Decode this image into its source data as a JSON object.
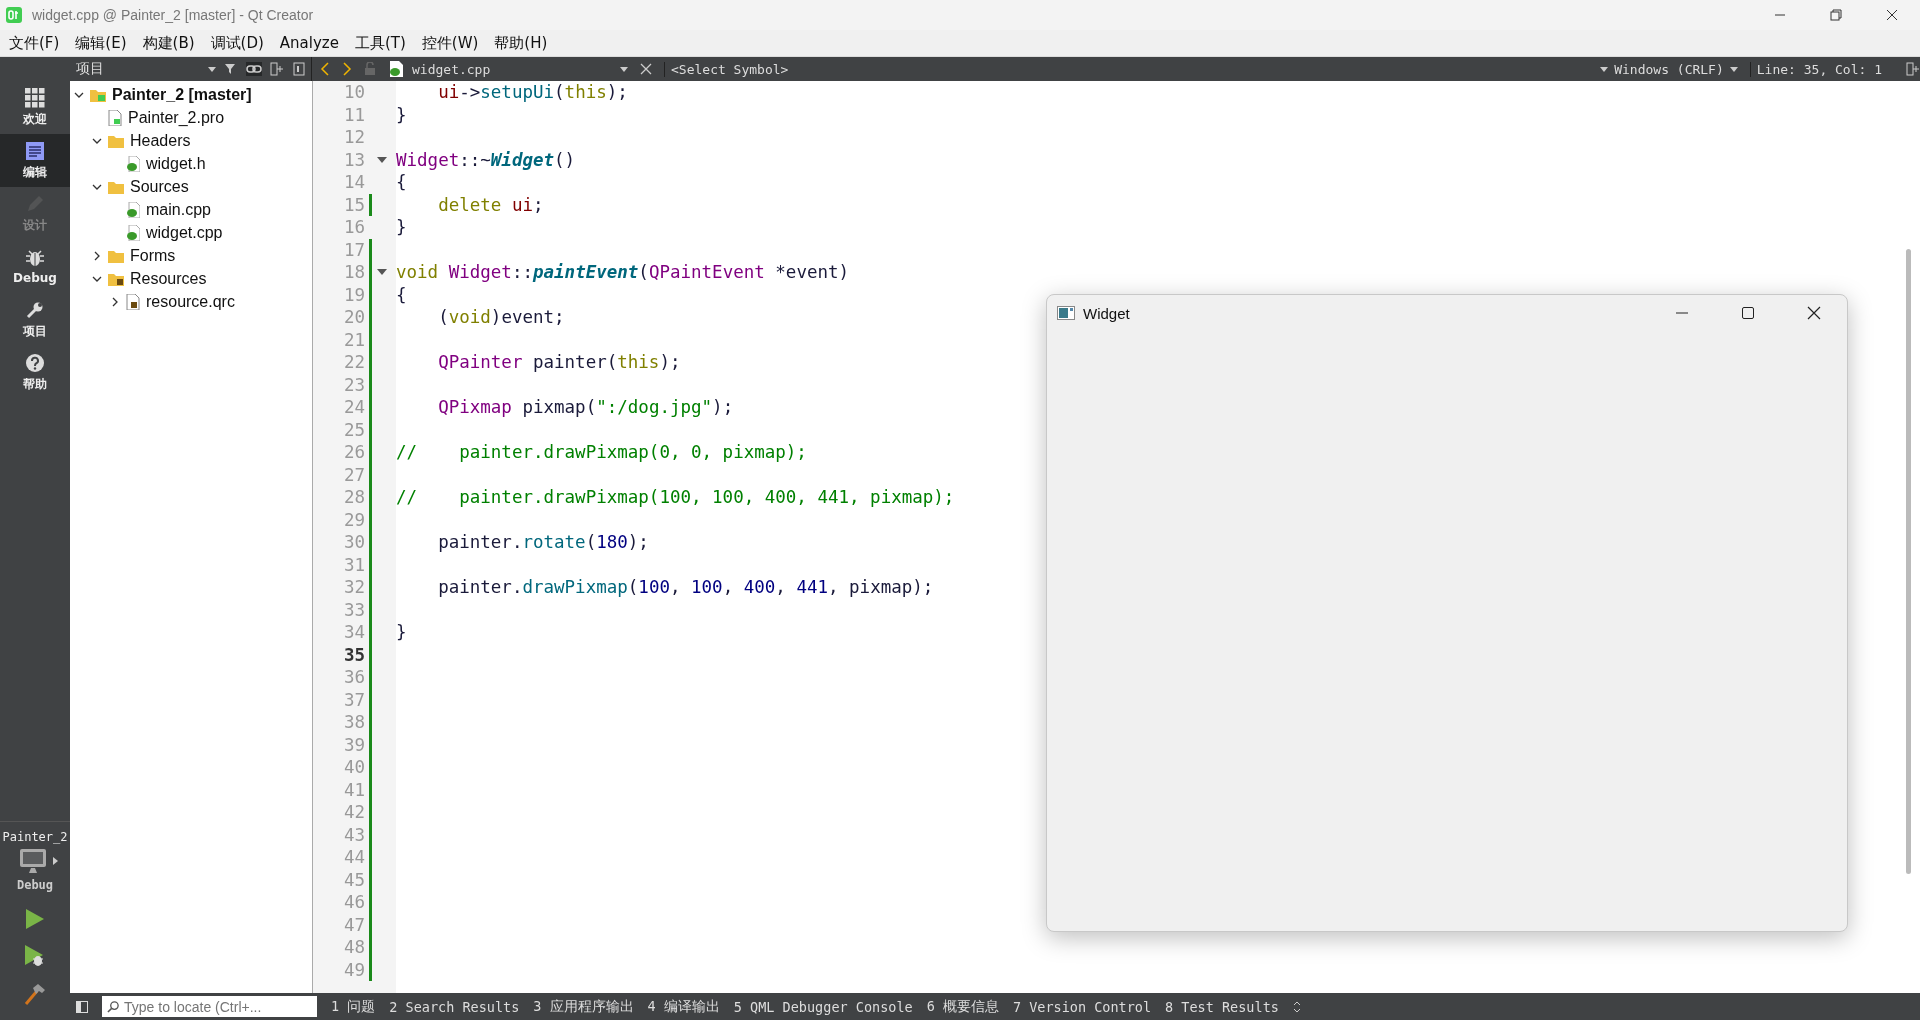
{
  "window": {
    "title": "widget.cpp @ Painter_2 [master] - Qt Creator"
  },
  "menu": [
    "文件(F)",
    "编辑(E)",
    "构建(B)",
    "调试(D)",
    "Analyze",
    "工具(T)",
    "控件(W)",
    "帮助(H)"
  ],
  "mode_bar": {
    "modes": [
      {
        "label": "欢迎",
        "kind": "welcome",
        "selected": false,
        "disabled": false
      },
      {
        "label": "编辑",
        "kind": "edit",
        "selected": true,
        "disabled": false
      },
      {
        "label": "设计",
        "kind": "design",
        "selected": false,
        "disabled": true
      },
      {
        "label": "Debug",
        "kind": "debug",
        "selected": false,
        "disabled": false
      },
      {
        "label": "项目",
        "kind": "projects",
        "selected": false,
        "disabled": false
      },
      {
        "label": "帮助",
        "kind": "help",
        "selected": false,
        "disabled": false
      }
    ],
    "target": {
      "project": "Painter_2",
      "build": "Debug"
    },
    "actions": [
      {
        "kind": "run"
      },
      {
        "kind": "debug-run"
      },
      {
        "kind": "build"
      }
    ]
  },
  "project_pane": {
    "title": "项目",
    "tree": [
      {
        "label": "Painter_2 [master]",
        "kind": "project",
        "expanded": true,
        "children": [
          {
            "label": "Painter_2.pro",
            "kind": "pro"
          },
          {
            "label": "Headers",
            "kind": "folder",
            "expanded": true,
            "children": [
              {
                "label": "widget.h",
                "kind": "source"
              }
            ]
          },
          {
            "label": "Sources",
            "kind": "folder",
            "expanded": true,
            "children": [
              {
                "label": "main.cpp",
                "kind": "source"
              },
              {
                "label": "widget.cpp",
                "kind": "source"
              }
            ]
          },
          {
            "label": "Forms",
            "kind": "folder",
            "expanded": false
          },
          {
            "label": "Resources",
            "kind": "resfolder",
            "expanded": true,
            "children": [
              {
                "label": "resource.qrc",
                "kind": "resource",
                "expanded": false
              }
            ]
          }
        ]
      }
    ]
  },
  "editor": {
    "file": "widget.cpp",
    "symbol": "<Select Symbol>",
    "line_ending": "Windows (CRLF)",
    "position": "Line: 35, Col: 1",
    "lines": [
      {
        "number": "10",
        "changed": false,
        "fold": false,
        "current": false,
        "tokens": [
          {
            "t": "    ui",
            "kind": "member"
          },
          {
            "t": "->",
            "kind": "plain"
          },
          {
            "t": "setupUi",
            "kind": "func"
          },
          {
            "t": "(",
            "kind": "plain"
          },
          {
            "t": "this",
            "kind": "keyword"
          },
          {
            "t": ");",
            "kind": "plain"
          }
        ]
      },
      {
        "number": "11",
        "changed": false,
        "fold": false,
        "current": false,
        "tokens": [
          {
            "t": "}",
            "kind": "plain"
          }
        ]
      },
      {
        "number": "12",
        "changed": false,
        "fold": false,
        "current": false
      },
      {
        "number": "13",
        "changed": false,
        "fold": true,
        "current": false,
        "tokens": [
          {
            "t": "Widget",
            "kind": "type"
          },
          {
            "t": "::~",
            "kind": "plain"
          },
          {
            "t": "Widget",
            "kind": "decl"
          },
          {
            "t": "()",
            "kind": "plain"
          }
        ]
      },
      {
        "number": "14",
        "changed": false,
        "fold": false,
        "current": false,
        "tokens": [
          {
            "t": "{",
            "kind": "plain"
          }
        ]
      },
      {
        "number": "15",
        "changed": true,
        "fold": false,
        "current": false,
        "tokens": [
          {
            "t": "    delete ",
            "kind": "keyword"
          },
          {
            "t": "ui",
            "kind": "member"
          },
          {
            "t": ";",
            "kind": "plain"
          }
        ]
      },
      {
        "number": "16",
        "changed": false,
        "fold": false,
        "current": false,
        "tokens": [
          {
            "t": "}",
            "kind": "plain"
          }
        ]
      },
      {
        "number": "17",
        "changed": true,
        "fold": false,
        "current": false
      },
      {
        "number": "18",
        "changed": true,
        "fold": true,
        "current": false,
        "tokens": [
          {
            "t": "void ",
            "kind": "keyword"
          },
          {
            "t": "Widget",
            "kind": "type"
          },
          {
            "t": "::",
            "kind": "plain"
          },
          {
            "t": "paintEvent",
            "kind": "decl"
          },
          {
            "t": "(",
            "kind": "plain"
          },
          {
            "t": "QPaintEvent",
            "kind": "type"
          },
          {
            "t": " *event)",
            "kind": "plain"
          }
        ]
      },
      {
        "number": "19",
        "changed": true,
        "fold": false,
        "current": false,
        "tokens": [
          {
            "t": "{",
            "kind": "plain"
          }
        ]
      },
      {
        "number": "20",
        "changed": true,
        "fold": false,
        "current": false,
        "tokens": [
          {
            "t": "    (",
            "kind": "plain"
          },
          {
            "t": "void",
            "kind": "keyword"
          },
          {
            "t": ")event;",
            "kind": "plain"
          }
        ]
      },
      {
        "number": "21",
        "changed": true,
        "fold": false,
        "current": false
      },
      {
        "number": "22",
        "changed": true,
        "fold": false,
        "current": false,
        "tokens": [
          {
            "t": "    QPainter",
            "kind": "type"
          },
          {
            "t": " painter(",
            "kind": "plain"
          },
          {
            "t": "this",
            "kind": "keyword"
          },
          {
            "t": ");",
            "kind": "plain"
          }
        ]
      },
      {
        "number": "23",
        "changed": true,
        "fold": false,
        "current": false
      },
      {
        "number": "24",
        "changed": true,
        "fold": false,
        "current": false,
        "tokens": [
          {
            "t": "    QPixmap",
            "kind": "type"
          },
          {
            "t": " pixmap(",
            "kind": "plain"
          },
          {
            "t": "\":/dog.jpg\"",
            "kind": "string"
          },
          {
            "t": ");",
            "kind": "plain"
          }
        ]
      },
      {
        "number": "25",
        "changed": true,
        "fold": false,
        "current": false
      },
      {
        "number": "26",
        "changed": true,
        "fold": false,
        "current": false,
        "tokens": [
          {
            "t": "//    painter.drawPixmap(0, 0, pixmap);",
            "kind": "comment"
          }
        ]
      },
      {
        "number": "27",
        "changed": true,
        "fold": false,
        "current": false
      },
      {
        "number": "28",
        "changed": true,
        "fold": false,
        "current": false,
        "tokens": [
          {
            "t": "//    painter.drawPixmap(100, 100, 400, 441, pixmap);",
            "kind": "comment"
          }
        ]
      },
      {
        "number": "29",
        "changed": true,
        "fold": false,
        "current": false
      },
      {
        "number": "30",
        "changed": true,
        "fold": false,
        "current": false,
        "tokens": [
          {
            "t": "    painter.",
            "kind": "plain"
          },
          {
            "t": "rotate",
            "kind": "func"
          },
          {
            "t": "(",
            "kind": "plain"
          },
          {
            "t": "180",
            "kind": "number"
          },
          {
            "t": ");",
            "kind": "plain"
          }
        ]
      },
      {
        "number": "31",
        "changed": true,
        "fold": false,
        "current": false
      },
      {
        "number": "32",
        "changed": true,
        "fold": false,
        "current": false,
        "tokens": [
          {
            "t": "    painter.",
            "kind": "plain"
          },
          {
            "t": "drawPixmap",
            "kind": "func"
          },
          {
            "t": "(",
            "kind": "plain"
          },
          {
            "t": "100",
            "kind": "number"
          },
          {
            "t": ", ",
            "kind": "plain"
          },
          {
            "t": "100",
            "kind": "number"
          },
          {
            "t": ", ",
            "kind": "plain"
          },
          {
            "t": "400",
            "kind": "number"
          },
          {
            "t": ", ",
            "kind": "plain"
          },
          {
            "t": "441",
            "kind": "number"
          },
          {
            "t": ", pixmap);",
            "kind": "plain"
          }
        ]
      },
      {
        "number": "33",
        "changed": true,
        "fold": false,
        "current": false
      },
      {
        "number": "34",
        "changed": true,
        "fold": false,
        "current": false,
        "tokens": [
          {
            "t": "}",
            "kind": "plain"
          }
        ]
      },
      {
        "number": "35",
        "changed": true,
        "fold": false,
        "current": true
      },
      {
        "number": "36",
        "changed": true,
        "fold": false,
        "current": false
      },
      {
        "number": "37",
        "changed": true,
        "fold": false,
        "current": false
      },
      {
        "number": "38",
        "changed": true,
        "fold": false,
        "current": false
      },
      {
        "number": "39",
        "changed": true,
        "fold": false,
        "current": false
      },
      {
        "number": "40",
        "changed": true,
        "fold": false,
        "current": false
      },
      {
        "number": "41",
        "changed": true,
        "fold": false,
        "current": false
      },
      {
        "number": "42",
        "changed": true,
        "fold": false,
        "current": false
      },
      {
        "number": "43",
        "changed": true,
        "fold": false,
        "current": false
      },
      {
        "number": "44",
        "changed": true,
        "fold": false,
        "current": false
      },
      {
        "number": "45",
        "changed": true,
        "fold": false,
        "current": false
      },
      {
        "number": "46",
        "changed": true,
        "fold": false,
        "current": false
      },
      {
        "number": "47",
        "changed": true,
        "fold": false,
        "current": false
      },
      {
        "number": "48",
        "changed": true,
        "fold": false,
        "current": false
      },
      {
        "number": "49",
        "changed": true,
        "fold": false,
        "current": false
      }
    ]
  },
  "widget_window": {
    "title": "Widget"
  },
  "status_bar": {
    "locate_placeholder": "Type to locate (Ctrl+...",
    "panes": [
      "1 问题",
      "2 Search Results",
      "3 应用程序输出",
      "4 编译输出",
      "5 QML Debugger Console",
      "6 概要信息",
      "7 Version Control",
      "8 Test Results"
    ]
  }
}
